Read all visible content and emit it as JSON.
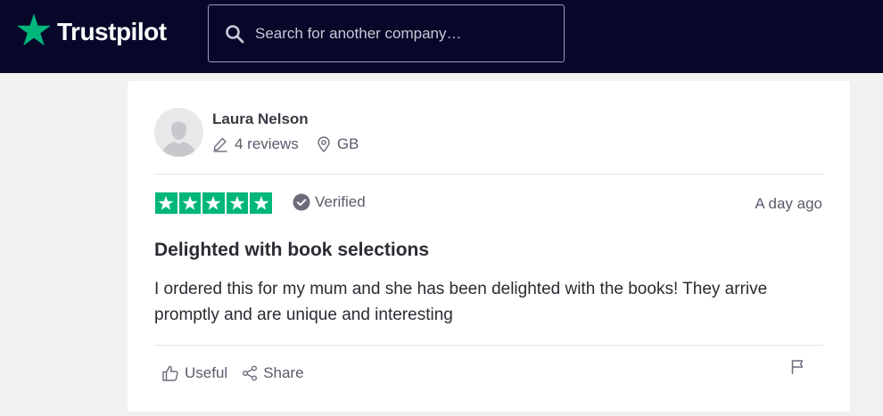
{
  "header": {
    "brand": "Trustpilot",
    "search_placeholder": "Search for another company…"
  },
  "review": {
    "reviewer_name": "Laura Nelson",
    "review_count": "4 reviews",
    "country": "GB",
    "rating": 5,
    "rating_max": 5,
    "verified_label": "Verified",
    "date": "A day ago",
    "title": "Delighted with book selections",
    "body": "I ordered this for my mum and she has been delighted with the books! They arrive promptly and are unique and interesting",
    "useful_label": "Useful",
    "share_label": "Share"
  },
  "colors": {
    "header_bg": "#07072a",
    "brand_green": "#00b67a",
    "page_bg": "#f1f1f3"
  },
  "icons": {
    "logo": "star-icon",
    "search": "search-icon",
    "reviews": "pencil-icon",
    "location": "location-pin-icon",
    "verified": "check-circle-icon",
    "useful": "thumbs-up-icon",
    "share": "share-icon",
    "report": "flag-icon"
  }
}
